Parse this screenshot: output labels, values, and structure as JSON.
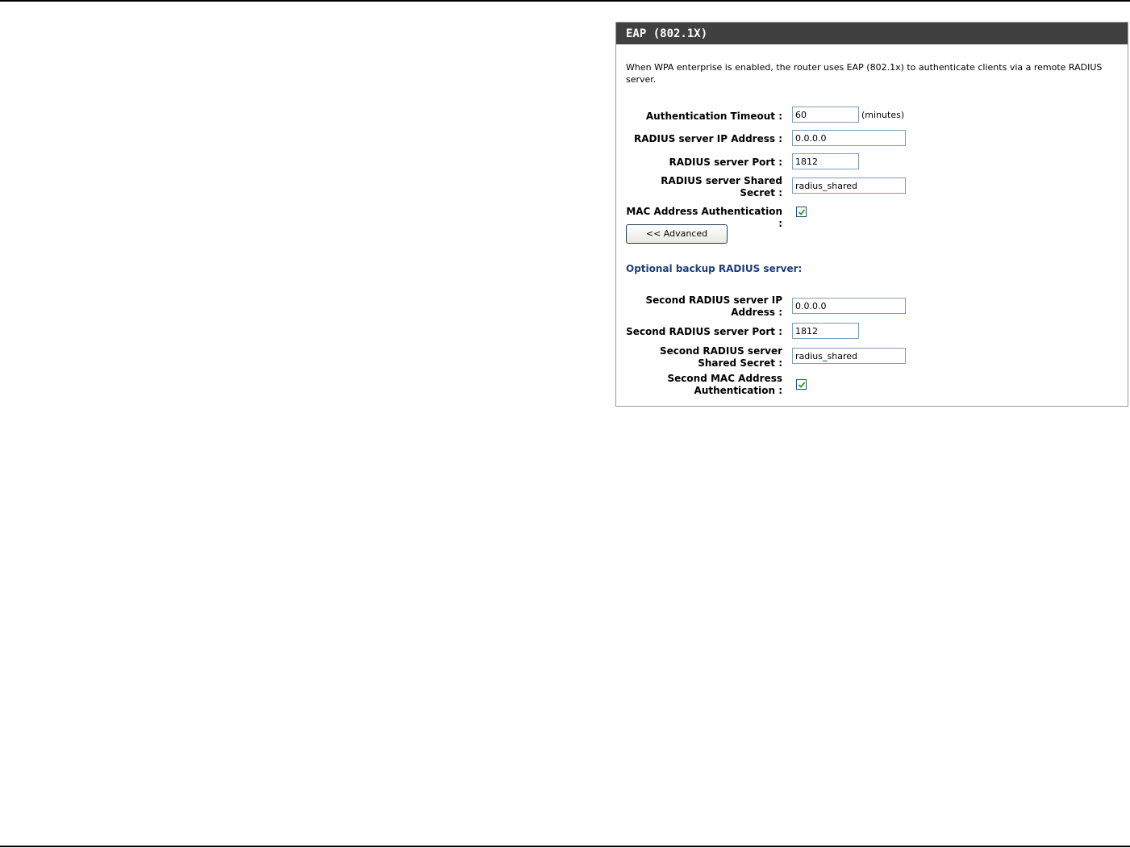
{
  "panel": {
    "title": "EAP (802.1X)",
    "description": "When WPA enterprise is enabled, the router uses EAP (802.1x) to authenticate clients via a remote RADIUS server."
  },
  "primary": {
    "auth_timeout_label": "Authentication Timeout :",
    "auth_timeout_value": "60",
    "auth_timeout_unit": "(minutes)",
    "ip_label": "RADIUS server IP Address :",
    "ip_value": "0.0.0.0",
    "port_label": "RADIUS server Port :",
    "port_value": "1812",
    "secret_label_line1": "RADIUS server Shared",
    "secret_label_line2": "Secret :",
    "secret_value": "radius_shared",
    "mac_label": "MAC Address Authentication :",
    "mac_checked": true
  },
  "advanced_button_label": "<< Advanced",
  "backup": {
    "section_title": "Optional backup RADIUS server:",
    "ip_label_line1": "Second RADIUS server IP",
    "ip_label_line2": "Address :",
    "ip_value": "0.0.0.0",
    "port_label": "Second RADIUS server Port :",
    "port_value": "1812",
    "secret_label_line1": "Second RADIUS server",
    "secret_label_line2": "Shared Secret :",
    "secret_value": "radius_shared",
    "mac_label_line1": "Second MAC Address",
    "mac_label_line2": "Authentication :",
    "mac_checked": true
  },
  "colors": {
    "header_bg": "#404040",
    "section_title": "#1c3f78",
    "checkmark": "#21a121"
  }
}
